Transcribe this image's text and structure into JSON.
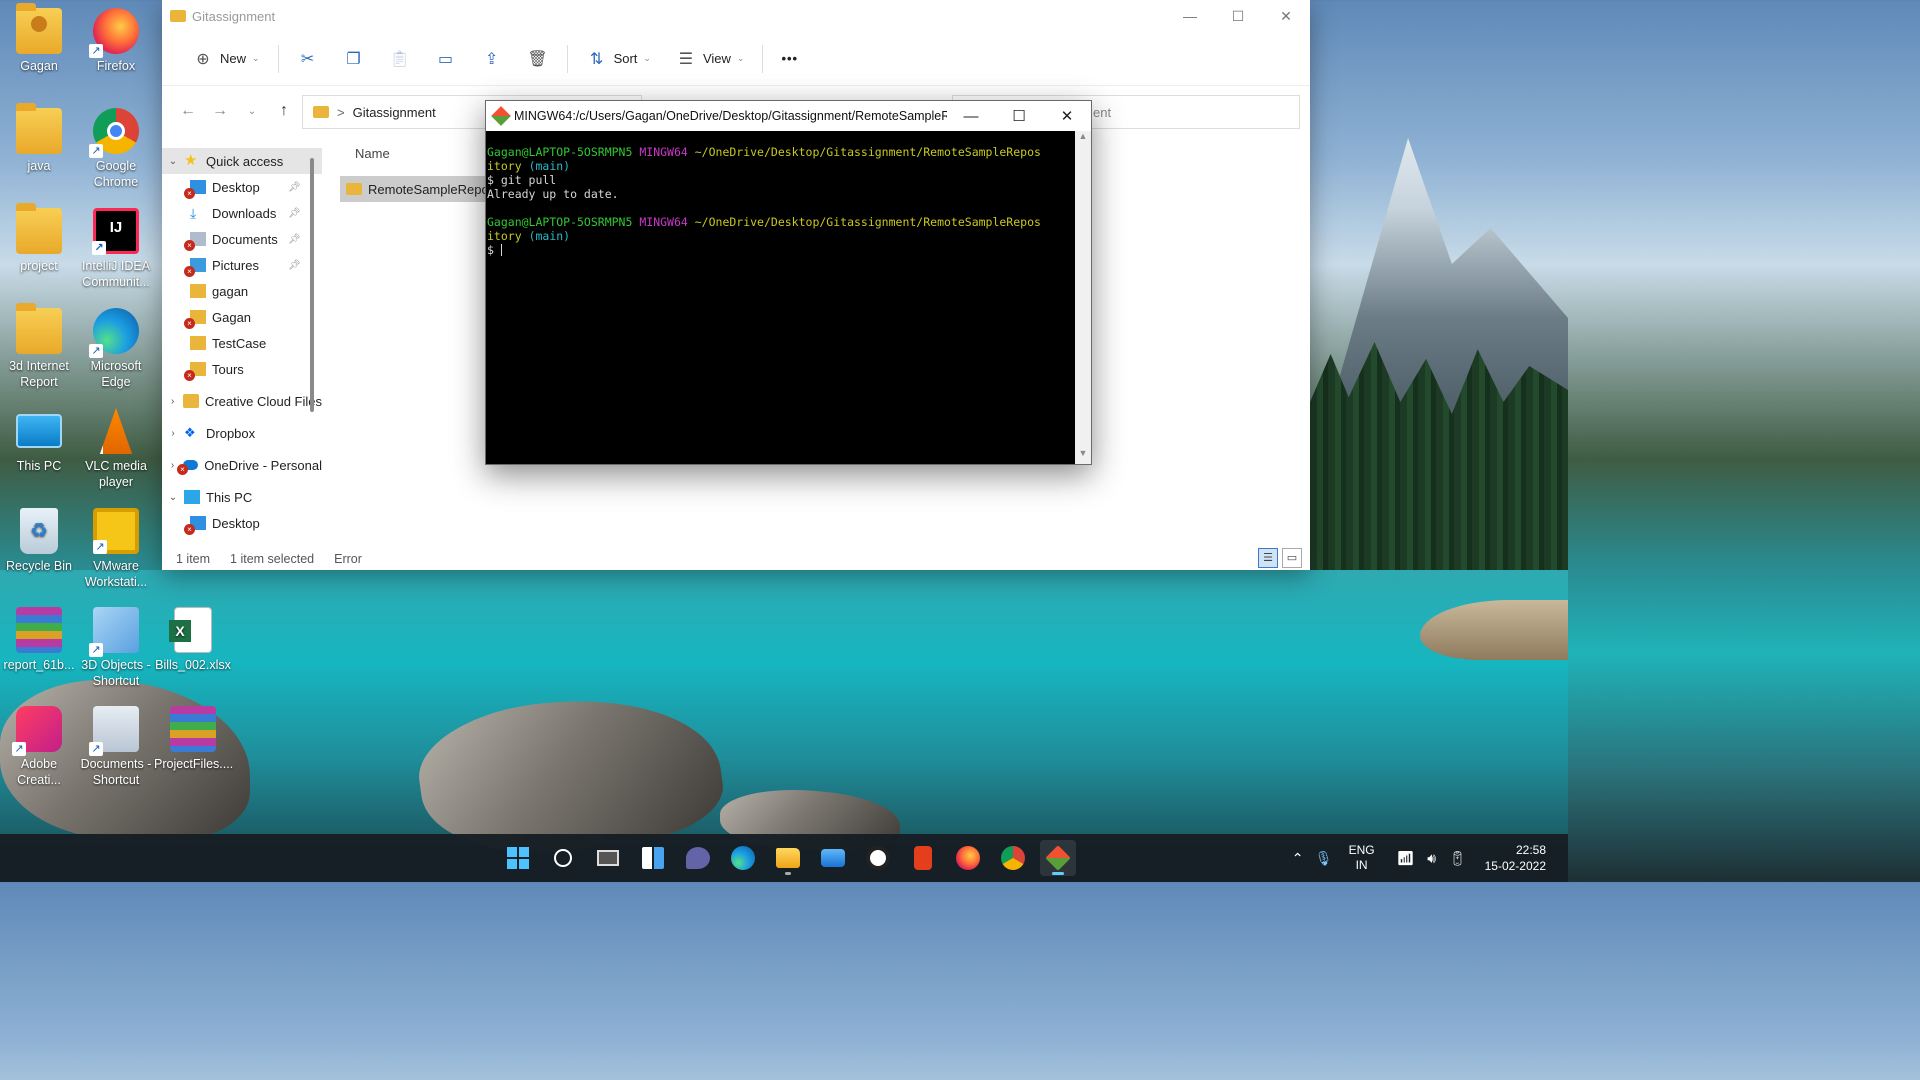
{
  "desktop": {
    "icons": [
      {
        "label": "Gagan",
        "icon": "folder-user-icon"
      },
      {
        "label": "Firefox",
        "icon": "firefox-icon"
      },
      {
        "label": "java",
        "icon": "folder-icon"
      },
      {
        "label": "Google Chrome",
        "icon": "chrome-icon"
      },
      {
        "label": "project",
        "icon": "folder-icon"
      },
      {
        "label": "IntelliJ IDEA Communit...",
        "icon": "intellij-icon"
      },
      {
        "label": "3d Internet Report",
        "icon": "folder-icon"
      },
      {
        "label": "Microsoft Edge",
        "icon": "edge-icon"
      },
      {
        "label": "This PC",
        "icon": "monitor-icon"
      },
      {
        "label": "VLC media player",
        "icon": "vlc-icon"
      },
      {
        "label": "Recycle Bin",
        "icon": "recycle-bin-icon"
      },
      {
        "label": "VMware Workstati...",
        "icon": "vmware-icon"
      },
      {
        "label": "report_61b...",
        "icon": "winrar-icon"
      },
      {
        "label": "3D Objects - Shortcut",
        "icon": "3d-objects-icon"
      },
      {
        "label": "Bills_002.xlsx",
        "icon": "excel-icon"
      },
      {
        "label": "Adobe Creati...",
        "icon": "adobe-cc-icon"
      },
      {
        "label": "Documents - Shortcut",
        "icon": "documents-icon"
      },
      {
        "label": "ProjectFiles....",
        "icon": "winrar-icon"
      }
    ]
  },
  "explorer": {
    "title": "Gitassignment",
    "toolbar": {
      "new_label": "New",
      "sort_label": "Sort",
      "view_label": "View",
      "more_label": "•••"
    },
    "address": {
      "folder": "Gitassignment",
      "separator": ">"
    },
    "search_hint": "ent",
    "nav": {
      "quick_access": "Quick access",
      "quick_items": [
        {
          "label": "Desktop",
          "pinned": true,
          "error": true
        },
        {
          "label": "Downloads",
          "pinned": true,
          "error": false
        },
        {
          "label": "Documents",
          "pinned": true,
          "error": true
        },
        {
          "label": "Pictures",
          "pinned": true,
          "error": true
        },
        {
          "label": "gagan",
          "pinned": false,
          "error": false
        },
        {
          "label": "Gagan",
          "pinned": false,
          "error": true
        },
        {
          "label": "TestCase",
          "pinned": false,
          "error": false
        },
        {
          "label": "Tours",
          "pinned": false,
          "error": true
        }
      ],
      "creative_cloud": "Creative Cloud Files",
      "dropbox": "Dropbox",
      "onedrive": "OneDrive - Personal",
      "this_pc": "This PC",
      "this_pc_desktop": "Desktop"
    },
    "column_name": "Name",
    "selected_item": "RemoteSampleRepository",
    "status": {
      "count": "1 item",
      "selected": "1 item selected",
      "error": "Error"
    }
  },
  "bash": {
    "title": "MINGW64:/c/Users/Gagan/OneDrive/Desktop/Gitassignment/RemoteSampleR...",
    "prompt_user": "Gagan@LAPTOP-5OSRMPN5",
    "prompt_env": "MINGW64",
    "prompt_path_1": "~/OneDrive/Desktop/Gitassignment/RemoteSampleRepos",
    "prompt_path_2": "itory",
    "branch": "(main)",
    "command": "$ git pull",
    "output": "Already up to date.",
    "prompt_symbol": "$"
  },
  "taskbar": {
    "apps": [
      "start-icon",
      "search-icon",
      "task-view-icon",
      "widgets-icon",
      "teams-chat-icon",
      "edge-icon",
      "file-explorer-icon",
      "mail-icon",
      "github-icon",
      "office-icon",
      "firefox-icon",
      "chrome-icon",
      "git-bash-icon"
    ],
    "lang_1": "ENG",
    "lang_2": "IN",
    "time": "22:58",
    "date": "15-02-2022"
  }
}
